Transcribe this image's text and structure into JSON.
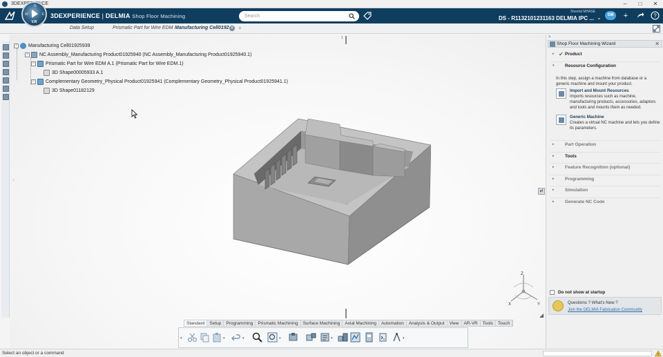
{
  "os": {
    "title": "3DEXPERIENCE",
    "controls": [
      "–",
      "□",
      "✕"
    ]
  },
  "header": {
    "brand": "3DEXPERIENCE",
    "separator": "|",
    "product": "DELMIA",
    "app": "Shop Floor Machining",
    "compass_version": "V.R",
    "compass_quadrants": [
      "N",
      "W",
      "E",
      "S"
    ],
    "search_placeholder": "Search",
    "user": "Sheetal MHASE",
    "platform": "DS - R1132101231163 DELMIA IPC ...",
    "avatar_initials": "SM"
  },
  "tabs": [
    {
      "label": "Data Setup",
      "active": false
    },
    {
      "label": "Prismatic Part for Wire EDM",
      "active": false
    },
    {
      "label": "Manufacturing Cell0192",
      "active": true
    }
  ],
  "tab_separator": "»",
  "tab_add": "+",
  "tree": [
    {
      "label": "Manufacturing Cell01925939",
      "icon": "cell-icon",
      "toggle": "−",
      "indent": 0
    },
    {
      "label": "NC Assembly_Manufacturing Product01925940 (NC Assembly_Manufacturing Product01925940.1)",
      "icon": "assembly-icon",
      "toggle": "−",
      "indent": 1
    },
    {
      "label": "Prismatic Part for Wire EDM A.1 (Prismatic Part for Wire EDM.1)",
      "icon": "part-icon",
      "toggle": "−",
      "indent": 2
    },
    {
      "label": "3D Shape00005933 A.1",
      "icon": "shape-icon",
      "toggle": "",
      "indent": 3
    },
    {
      "label": "Complementary Geometry_Physical Product01925941 (Complementary Geometry_Physical Product01925941.1)",
      "icon": "part-icon",
      "toggle": "−",
      "indent": 2
    },
    {
      "label": "3D Shape01182129",
      "icon": "shape-icon",
      "toggle": "",
      "indent": 3
    }
  ],
  "canvas": {
    "scroll_marker": "1",
    "axes": {
      "x": "X",
      "y": "Y",
      "z": "Z"
    }
  },
  "action_bar": {
    "tabs": [
      {
        "label": "Standard",
        "active": true
      },
      {
        "label": "Setup",
        "active": false
      },
      {
        "label": "Programming",
        "active": false
      },
      {
        "label": "Prismatic Machining",
        "active": false
      },
      {
        "label": "Surface Machining",
        "active": false
      },
      {
        "label": "Axial Machining",
        "active": false
      },
      {
        "label": "Automation",
        "active": false
      },
      {
        "label": "Analysis & Output",
        "active": false
      },
      {
        "label": "View",
        "active": false
      },
      {
        "label": "AR-VR",
        "active": false
      },
      {
        "label": "Tools",
        "active": false
      },
      {
        "label": "Touch",
        "active": false
      }
    ],
    "tools": [
      "cut-icon",
      "copy-icon",
      "paste-icon",
      "undo-icon",
      "zoom-icon",
      "fit-all-icon",
      "machine-icon",
      "part-operation-icon",
      "program-icon",
      "simulation-icon",
      "tool-path-icon",
      "output-icon",
      "nc-code-icon",
      "compass-tool-icon"
    ]
  },
  "wizard": {
    "title": "Shop Floor Machining Wizard",
    "top_arrow": ">",
    "close": "✕",
    "steps": [
      {
        "label": "Product",
        "state": "done",
        "caret": "▸"
      },
      {
        "label": "Resource Configuration",
        "state": "open",
        "caret": "▾"
      },
      {
        "label": "Part Operation",
        "state": "pending",
        "caret": "▸"
      },
      {
        "label": "Tools",
        "state": "pending-bold",
        "caret": "▸"
      },
      {
        "label": "Feature Recognition (optional)",
        "state": "pending",
        "caret": "▸"
      },
      {
        "label": "Programming",
        "state": "pending",
        "caret": "▸"
      },
      {
        "label": "Simulation",
        "state": "pending",
        "caret": "▸"
      },
      {
        "label": "Generate NC Code",
        "state": "pending",
        "caret": "▸"
      }
    ],
    "resource_config": {
      "description": "In this step, assign a machine from database or a generic machine and mount your product.",
      "items": [
        {
          "title": "Import and Mount Resources",
          "desc": "Imports resources such as machine, manufacturing products, accessories, adaptors and tools and mounts them as needed."
        },
        {
          "title": "Generic Machine",
          "desc": "Creates a virtual NC machine and lets you define its parameters."
        }
      ]
    },
    "startup_label": "Do not show at startup",
    "help_question": "Questions ? What's New ?",
    "help_link": "Join the DELMIA Fabrication Community"
  },
  "status": {
    "text": "Select an object or a command"
  },
  "colors": {
    "header_bg": "#0f3d5e",
    "accent_link": "#2a6db0",
    "check_green": "#2e8b2e",
    "model_gray": "#9a9a9a"
  }
}
